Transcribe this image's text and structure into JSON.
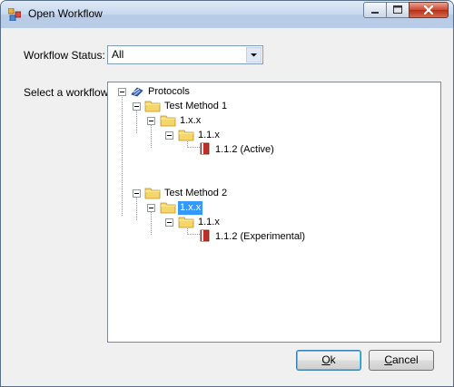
{
  "window": {
    "title": "Open Workflow",
    "icon": "workflow-app-icon",
    "controls": [
      "minimize-icon",
      "maximize-icon",
      "close-icon"
    ]
  },
  "form": {
    "status_label": "Workflow Status:",
    "status_value": "All",
    "select_label": "Select a workflow:"
  },
  "tree": {
    "root": "Protocols",
    "nodes": [
      {
        "label": "Protocols",
        "icon": "protocols-icon"
      },
      {
        "label": "Test Method 1",
        "icon": "folder-icon"
      },
      {
        "label": "1.x.x",
        "icon": "folder-icon"
      },
      {
        "label": "1.1.x",
        "icon": "folder-icon"
      },
      {
        "label": "1.1.2 (Active)",
        "icon": "book-icon"
      },
      {
        "label": "Test Method 2",
        "icon": "folder-icon"
      },
      {
        "label": "1.x.x",
        "icon": "folder-icon",
        "selected": true
      },
      {
        "label": "1.1.x",
        "icon": "folder-icon"
      },
      {
        "label": "1.1.2 (Experimental)",
        "icon": "book-icon"
      }
    ]
  },
  "buttons": {
    "ok_mnemonic": "O",
    "ok_rest": "k",
    "cancel_mnemonic": "C",
    "cancel_rest": "ancel"
  },
  "colors": {
    "selection": "#3399ff",
    "folder": "#f5d66b",
    "book": "#c0302a"
  }
}
